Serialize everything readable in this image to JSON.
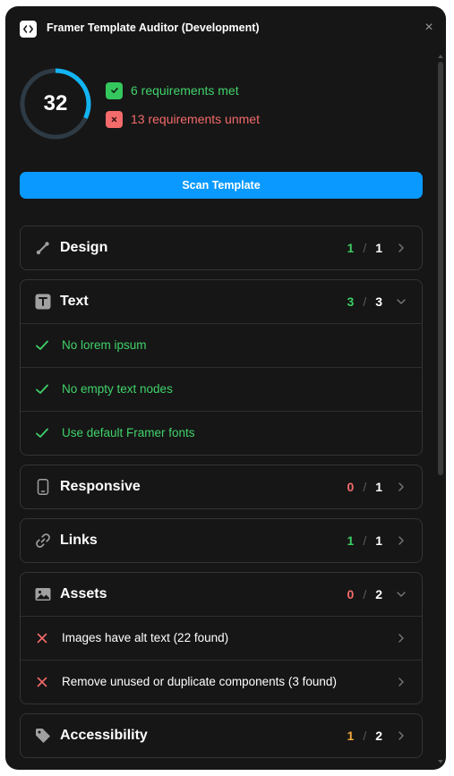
{
  "window": {
    "title": "Framer Template Auditor (Development)",
    "close_label": "×"
  },
  "score": {
    "value": "32",
    "progress_percent": 32,
    "ring_color": "#12b4f4",
    "track_color": "#2e3a44"
  },
  "requirements": {
    "met_label": "6 requirements met",
    "unmet_label": "13 requirements unmet",
    "met_icon": "check-icon",
    "unmet_icon": "x-icon"
  },
  "scan_button": {
    "label": "Scan Template"
  },
  "sections": [
    {
      "key": "design",
      "title": "Design",
      "icon": "pen-tool-icon",
      "passed": "1",
      "separator": "/",
      "total": "1",
      "expanded": false,
      "status": "green",
      "items": []
    },
    {
      "key": "text",
      "title": "Text",
      "icon": "text-icon",
      "passed": "3",
      "separator": "/",
      "total": "3",
      "expanded": true,
      "status": "green",
      "items": [
        {
          "label": "No lorem ipsum",
          "result": "pass"
        },
        {
          "label": "No empty text nodes",
          "result": "pass"
        },
        {
          "label": "Use default Framer fonts",
          "result": "pass"
        }
      ]
    },
    {
      "key": "responsive",
      "title": "Responsive",
      "icon": "phone-icon",
      "passed": "0",
      "separator": "/",
      "total": "1",
      "expanded": false,
      "status": "red",
      "items": []
    },
    {
      "key": "links",
      "title": "Links",
      "icon": "link-icon",
      "passed": "1",
      "separator": "/",
      "total": "1",
      "expanded": false,
      "status": "green",
      "items": []
    },
    {
      "key": "assets",
      "title": "Assets",
      "icon": "image-icon",
      "passed": "0",
      "separator": "/",
      "total": "2",
      "expanded": true,
      "status": "red",
      "items": [
        {
          "label": "Images have alt text (22 found)",
          "result": "fail"
        },
        {
          "label": "Remove unused or duplicate components (3 found)",
          "result": "fail"
        }
      ]
    },
    {
      "key": "accessibility",
      "title": "Accessibility",
      "icon": "tag-icon",
      "passed": "1",
      "separator": "/",
      "total": "2",
      "expanded": false,
      "status": "orange",
      "items": []
    }
  ]
}
